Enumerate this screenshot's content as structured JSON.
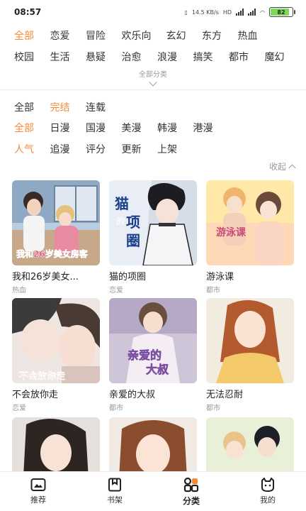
{
  "status": {
    "time": "08:57",
    "network": "14.5 KB/s",
    "battery": "82"
  },
  "genres": {
    "row1": [
      "全部",
      "恋爱",
      "冒险",
      "欢乐向",
      "玄幻",
      "东方",
      "热血"
    ],
    "row2": [
      "校园",
      "生活",
      "悬疑",
      "治愈",
      "浪漫",
      "搞笑",
      "都市",
      "魔幻"
    ],
    "all_label": "全部分类"
  },
  "filters": {
    "status": [
      "全部",
      "完结",
      "连载"
    ],
    "region": [
      "全部",
      "日漫",
      "国漫",
      "美漫",
      "韩漫",
      "港漫"
    ],
    "sort": [
      "人气",
      "追漫",
      "评分",
      "更新",
      "上架"
    ]
  },
  "collapse_label": "收起",
  "comics": [
    {
      "title": "我和26岁美女...",
      "tag": "热血"
    },
    {
      "title": "猫的项圈",
      "tag": "恋爱"
    },
    {
      "title": "游泳课",
      "tag": "都市"
    },
    {
      "title": "不会放你走",
      "tag": "恋爱"
    },
    {
      "title": "亲爱的大叔",
      "tag": "都市"
    },
    {
      "title": "无法忍耐",
      "tag": "都市"
    },
    {
      "title": "",
      "tag": ""
    },
    {
      "title": "",
      "tag": ""
    },
    {
      "title": "",
      "tag": ""
    }
  ],
  "cover_text": {
    "c1": "我和26岁美女房客",
    "c2a": "猫",
    "c2b": "的",
    "c2c": "项",
    "c2d": "圈",
    "c3": "游泳课",
    "c4": "不会放你走",
    "c5a": "亲爱的",
    "c5b": "大叔"
  },
  "tabs": [
    "推荐",
    "书架",
    "分类",
    "我的"
  ],
  "colors": {
    "accent": "#f58b3a"
  }
}
